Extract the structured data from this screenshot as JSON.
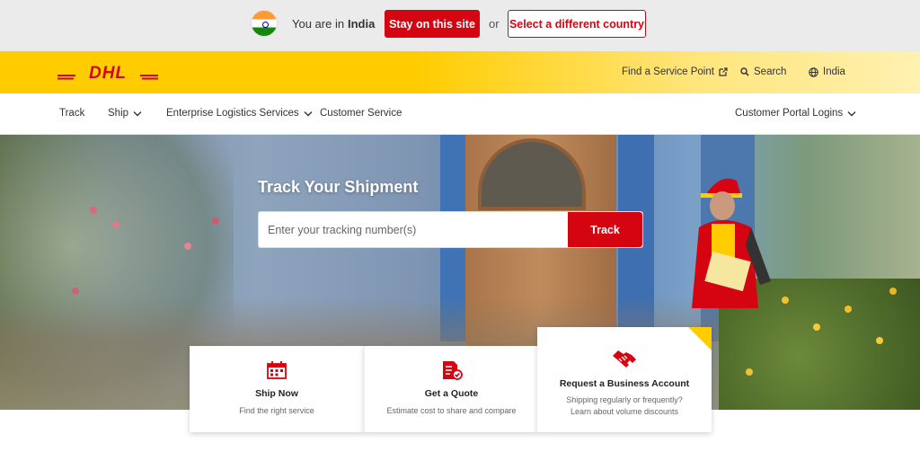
{
  "country_banner": {
    "prefix": "You are in",
    "country": "India",
    "stay_label": "Stay on this site",
    "or_label": "or",
    "select_label": "Select a different country"
  },
  "brand": {
    "logo_text": "DHL",
    "colors": {
      "yellow": "#ffcc00",
      "red": "#d40511"
    }
  },
  "utility": {
    "service_point": "Find a Service Point",
    "search": "Search",
    "region": "India"
  },
  "nav": {
    "items": [
      {
        "label": "Track",
        "has_dropdown": false
      },
      {
        "label": "Ship",
        "has_dropdown": true
      },
      {
        "label": "Enterprise Logistics Services",
        "has_dropdown": true
      },
      {
        "label": "Customer Service",
        "has_dropdown": false
      }
    ],
    "portal_label": "Customer Portal Logins"
  },
  "hero": {
    "title": "Track Your Shipment",
    "placeholder": "Enter your tracking number(s)",
    "track_button": "Track"
  },
  "cards": [
    {
      "icon": "calendar-icon",
      "title": "Ship Now",
      "desc": "Find the right service"
    },
    {
      "icon": "quote-document-icon",
      "title": "Get a Quote",
      "desc": "Estimate cost to share and compare"
    },
    {
      "icon": "handshake-icon",
      "title": "Request a Business Account",
      "desc": "Shipping regularly or frequently? Learn about volume discounts"
    }
  ]
}
